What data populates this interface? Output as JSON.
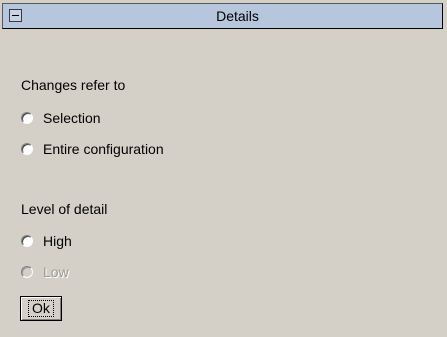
{
  "titlebar": {
    "title": "Details",
    "collapse_icon": "minus-box-icon"
  },
  "changes_section": {
    "label": "Changes refer to",
    "options": [
      {
        "label": "Selection",
        "selected": false,
        "enabled": true
      },
      {
        "label": "Entire configuration",
        "selected": false,
        "enabled": true
      }
    ]
  },
  "detail_section": {
    "label": "Level of detail",
    "options": [
      {
        "label": "High",
        "selected": false,
        "enabled": true
      },
      {
        "label": "Low",
        "selected": false,
        "enabled": false
      }
    ]
  },
  "ok_button": {
    "label": "Ok"
  },
  "colors": {
    "titlebar_bg": "#b6c6dc",
    "dialog_bg": "#d4d0c8"
  }
}
